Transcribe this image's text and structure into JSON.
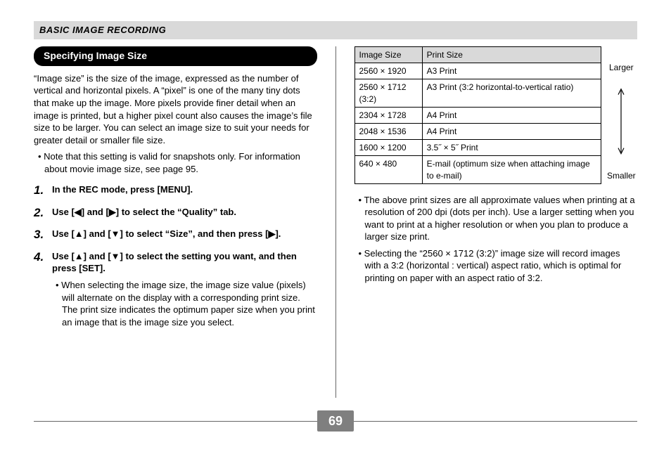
{
  "header": "BASIC IMAGE RECORDING",
  "page_number": "69",
  "section_title": "Specifying Image Size",
  "intro": "“Image size” is the size of the image, expressed as the number of vertical and horizontal pixels. A “pixel” is one of the many tiny dots that make up the image. More pixels provide finer detail when an image is printed, but a higher pixel count also causes the image’s file size to be larger. You can select an image size to suit your needs for greater detail or smaller file size.",
  "intro_note": "Note that this setting is valid for snapshots only. For information about movie image size, see page 95.",
  "steps": [
    "In the REC mode, press [MENU].",
    "Use [◀] and [▶] to select the “Quality” tab.",
    "Use [▲] and [▼] to select “Size”, and then press [▶].",
    "Use [▲] and [▼] to select the setting you want, and then press [SET]."
  ],
  "step4_sub": "When selecting the image size, the image size value (pixels) will alternate on the display with a corresponding print size. The print size indicates the optimum paper size when you print an image that is the image size you select.",
  "table": {
    "head": [
      "Image Size",
      "Print Size"
    ],
    "rows": [
      [
        "2560 × 1920",
        "A3 Print"
      ],
      [
        "2560 × 1712 (3:2)",
        "A3 Print (3:2 horizontal-to-vertical ratio)"
      ],
      [
        "2304 × 1728",
        "A4 Print"
      ],
      [
        "2048 × 1536",
        "A4 Print"
      ],
      [
        "1600 × 1200",
        "3.5˝ × 5˝ Print"
      ],
      [
        "640 × 480",
        "E-mail (optimum size when attaching image to e-mail)"
      ]
    ]
  },
  "scale": {
    "top": "Larger",
    "bottom": "Smaller"
  },
  "right_bullets": [
    "The above print sizes are all approximate values when printing at a resolution of 200 dpi (dots per inch). Use a larger setting when you want to print at a higher resolution or when you plan to produce a larger size print.",
    "Selecting the “2560 × 1712 (3:2)” image size will record images with a 3:2 (horizontal : vertical) aspect ratio, which is optimal for printing on paper with an aspect ratio of 3:2."
  ]
}
